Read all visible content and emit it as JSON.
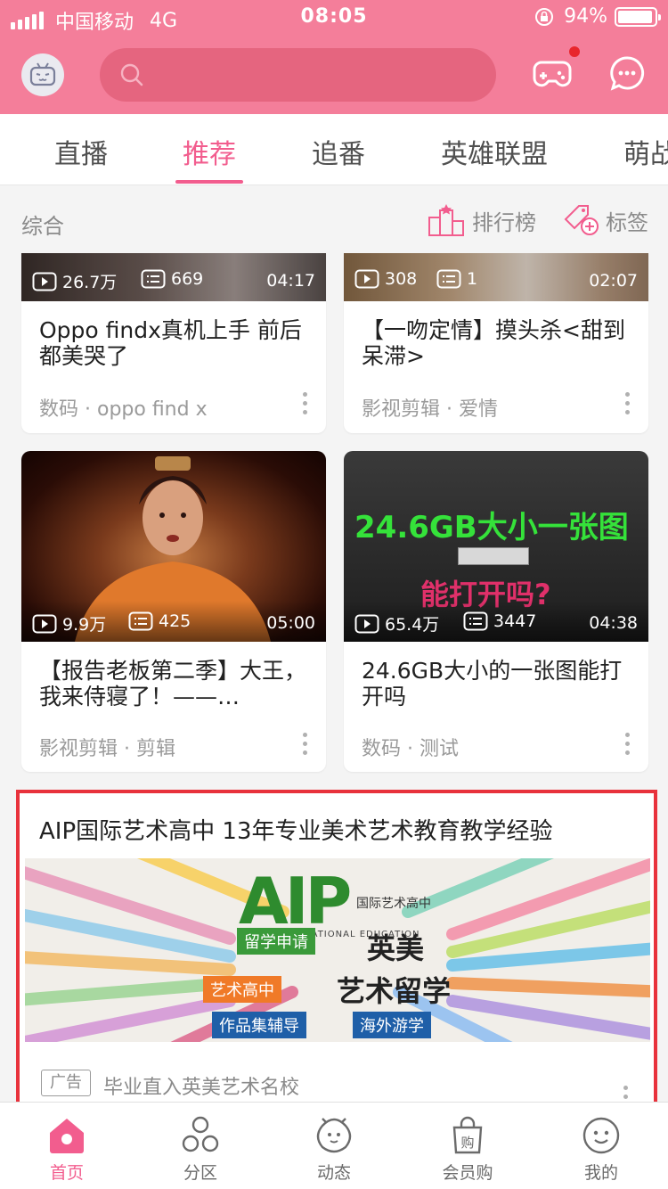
{
  "status_bar": {
    "carrier": "中国移动",
    "network": "4G",
    "time": "08:05",
    "battery": "94%",
    "battery_level": 0.94
  },
  "colors": {
    "brand_pink": "#f47e9a",
    "accent_pink": "#f25d8e",
    "ad_border": "#e8323c"
  },
  "header": {
    "avatar_icon": "tv-mascot-icon",
    "search_icon": "search-icon",
    "game_icon": "gamepad-icon",
    "message_icon": "chat-bubble-icon"
  },
  "tabs": [
    {
      "label": "直播",
      "active": false
    },
    {
      "label": "推荐",
      "active": true
    },
    {
      "label": "追番",
      "active": false
    },
    {
      "label": "英雄联盟",
      "active": false
    },
    {
      "label": "萌战",
      "active": false
    }
  ],
  "section": {
    "title": "综合",
    "rank_label": "排行榜",
    "tag_label": "标签"
  },
  "videos": [
    {
      "plays": "26.7万",
      "danmaku": "669",
      "duration": "04:17",
      "title": "Oppo findx真机上手 前后都美哭了",
      "meta": "数码 · oppo find x"
    },
    {
      "plays": "308",
      "danmaku": "1",
      "duration": "02:07",
      "title": "【一吻定情】摸头杀<甜到呆滞>",
      "meta": "影视剪辑 · 爱情"
    },
    {
      "plays": "9.9万",
      "danmaku": "425",
      "duration": "05:00",
      "title": "【报告老板第二季】大王，我来侍寝了！——…",
      "meta": "影视剪辑 · 剪辑"
    },
    {
      "plays": "65.4万",
      "danmaku": "3447",
      "duration": "04:38",
      "title": "24.6GB大小的一张图能打开吗",
      "meta": "数码 · 测试",
      "thumb_line1": "24.6GB大小一张图",
      "thumb_line2": "能打开吗?"
    }
  ],
  "ad": {
    "title": "AIP国际艺术高中 13年专业美术艺术教育教学经验",
    "badge": "广告",
    "description": "毕业直入英美艺术名校",
    "image": {
      "logo": "AIP",
      "logo_sub": "国际艺术高中",
      "logo_en": "ART INTERNATIONAL EDUCATION",
      "tag_study": "留学申请",
      "tag_art_high": "艺术高中",
      "tag_portfolio": "作品集辅导",
      "tag_overseas": "海外游学",
      "text_uk_us": "英美",
      "text_art_study": "艺术留学"
    }
  },
  "bottom_nav": [
    {
      "label": "首页",
      "icon": "home-icon",
      "active": true
    },
    {
      "label": "分区",
      "icon": "category-icon",
      "active": false
    },
    {
      "label": "动态",
      "icon": "moments-icon",
      "active": false
    },
    {
      "label": "会员购",
      "icon": "shopping-bag-icon",
      "active": false
    },
    {
      "label": "我的",
      "icon": "profile-icon",
      "active": false
    }
  ]
}
